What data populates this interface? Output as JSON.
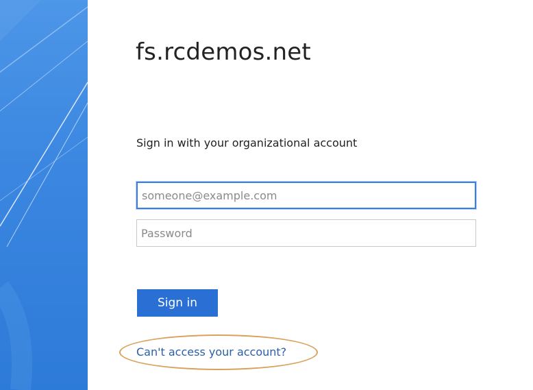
{
  "header": {
    "site_title": "fs.rcdemos.net"
  },
  "form": {
    "heading": "Sign in with your organizational account",
    "email_placeholder": "someone@example.com",
    "email_value": "",
    "password_placeholder": "Password",
    "password_value": "",
    "submit_label": "Sign in",
    "help_link": "Can't access your account?"
  },
  "colors": {
    "accent": "#2a6fd4",
    "side_panel": "#3a86e0",
    "link": "#2a5fa8",
    "highlight_annotation": "#d9a15a"
  }
}
